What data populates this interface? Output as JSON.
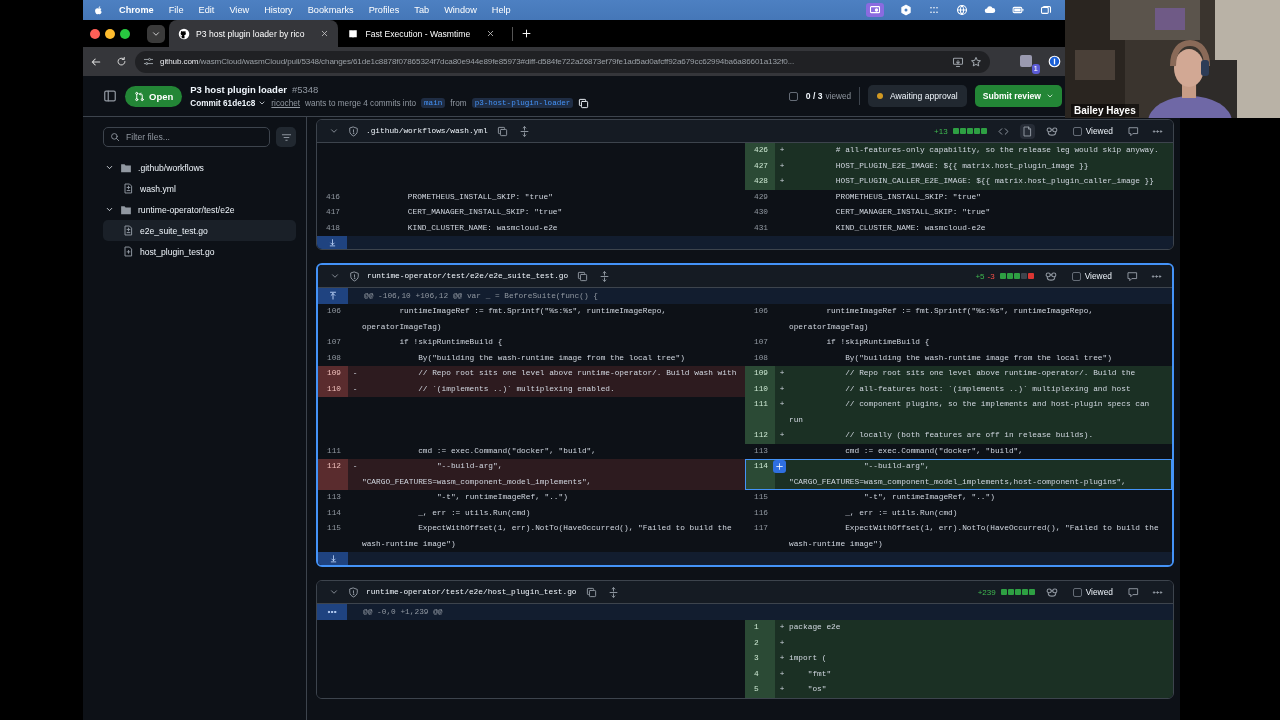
{
  "menubar": {
    "app": "Chrome",
    "menus": [
      "File",
      "Edit",
      "View",
      "History",
      "Bookmarks",
      "Profiles",
      "Tab",
      "Window",
      "Help"
    ]
  },
  "tabs": [
    {
      "title": "P3 host plugin loader by rico",
      "selected": true,
      "kind": "github"
    },
    {
      "title": "Fast Execution - Wasmtime",
      "selected": false,
      "kind": "book"
    }
  ],
  "address_bar": {
    "domain": "github.com",
    "path": "/wasmCloud/wasmCloud/pull/5348/changes/61de1c8878f07865324f7dca80e944e89fe85973#diff-d584fe722a26873ef79fe1ad5ad0afcff92a679cc62994ba6a86601a132f0...",
    "extension_badge": "1"
  },
  "pull_request": {
    "status": "Open",
    "title": "P3 host plugin loader",
    "number": "#5348",
    "commit": "Commit 61de1c8",
    "author": "ricochet",
    "merge_text": "wants to merge 4 commits into",
    "base": "main",
    "from_text": "from",
    "head": "p3-host-plugin-loader",
    "viewed_count": "0 / 3",
    "viewed_label": "viewed",
    "viewed_checked": false,
    "approval": "Awaiting approval",
    "submit": "Submit review"
  },
  "sidebar": {
    "filter_placeholder": "Filter files...",
    "tree": [
      {
        "name": ".github/workflows",
        "kind": "folder",
        "expanded": true,
        "children": [
          {
            "name": "wash.yml",
            "kind": "modified",
            "selected": false
          }
        ]
      },
      {
        "name": "runtime-operator/test/e2e",
        "kind": "folder",
        "expanded": true,
        "children": [
          {
            "name": "e2e_suite_test.go",
            "kind": "modified",
            "selected": true
          },
          {
            "name": "host_plugin_test.go",
            "kind": "added",
            "selected": false
          }
        ]
      }
    ]
  },
  "files": [
    {
      "path": ".github/workflows/wash.yml",
      "selected": false,
      "additions": "+13",
      "diffstat": [
        {
          "color": "#2ea043"
        },
        {
          "color": "#2ea043"
        },
        {
          "color": "#2ea043"
        },
        {
          "color": "#2ea043"
        },
        {
          "color": "#2ea043"
        }
      ],
      "view_toggle": true,
      "viewed": false,
      "viewed_label": "Viewed",
      "expand_below": true,
      "rows": [
        {
          "left": {
            "kind": "empty"
          },
          "right": {
            "kind": "add",
            "num": "426",
            "sign": "+",
            "code": "          # all-features-only capability, so the release leg would skip anyway."
          }
        },
        {
          "left": {
            "kind": "empty"
          },
          "right": {
            "kind": "add",
            "num": "427",
            "sign": "+",
            "code": "          HOST_PLUGIN_E2E_IMAGE: ${{ matrix.host_plugin_image }}"
          }
        },
        {
          "left": {
            "kind": "empty"
          },
          "right": {
            "kind": "add",
            "num": "428",
            "sign": "+",
            "code": "          HOST_PLUGIN_CALLER_E2E_IMAGE: ${{ matrix.host_plugin_caller_image }}"
          }
        },
        {
          "left": {
            "kind": "ctx",
            "num": "416",
            "code": "          PROMETHEUS_INSTALL_SKIP: \"true\""
          },
          "right": {
            "kind": "ctx",
            "num": "429",
            "code": "          PROMETHEUS_INSTALL_SKIP: \"true\""
          }
        },
        {
          "left": {
            "kind": "ctx",
            "num": "417",
            "code": "          CERT_MANAGER_INSTALL_SKIP: \"true\""
          },
          "right": {
            "kind": "ctx",
            "num": "430",
            "code": "          CERT_MANAGER_INSTALL_SKIP: \"true\""
          }
        },
        {
          "left": {
            "kind": "ctx",
            "num": "418",
            "code": "          KIND_CLUSTER_NAME: wasmcloud-e2e"
          },
          "right": {
            "kind": "ctx",
            "num": "431",
            "code": "          KIND_CLUSTER_NAME: wasmcloud-e2e"
          }
        }
      ]
    },
    {
      "path": "runtime-operator/test/e2e/e2e_suite_test.go",
      "selected": true,
      "additions": "+5",
      "deletions": "-3",
      "diffstat": [
        {
          "color": "#2ea043"
        },
        {
          "color": "#2ea043"
        },
        {
          "color": "#2ea043"
        },
        {
          "color": "#3d444d"
        },
        {
          "color": "#da3633"
        }
      ],
      "view_toggle": false,
      "viewed": false,
      "viewed_label": "Viewed",
      "expand_below": true,
      "hunk": {
        "text": "@@ -106,10 +106,12 @@ var _ = BeforeSuite(func() {",
        "kind": "up"
      },
      "rows": [
        {
          "left": {
            "kind": "ctx",
            "num": "106",
            "code": "        runtimeImageRef := fmt.Sprintf(\"%s:%s\", runtimeImageRepo, operatorImageTag)"
          },
          "right": {
            "kind": "ctx",
            "num": "106",
            "code": "        runtimeImageRef := fmt.Sprintf(\"%s:%s\", runtimeImageRepo, operatorImageTag)"
          }
        },
        {
          "left": {
            "kind": "ctx",
            "num": "107",
            "code": "        if !skipRuntimeBuild {"
          },
          "right": {
            "kind": "ctx",
            "num": "107",
            "code": "        if !skipRuntimeBuild {"
          }
        },
        {
          "left": {
            "kind": "ctx",
            "num": "108",
            "code": "            By(\"building the wash-runtime image from the local tree\")"
          },
          "right": {
            "kind": "ctx",
            "num": "108",
            "code": "            By(\"building the wash-runtime image from the local tree\")"
          }
        },
        {
          "left": {
            "kind": "del",
            "num": "109",
            "sign": "-",
            "code": "            // Repo root sits one level above runtime-operator/. Build wash with"
          },
          "right": {
            "kind": "add",
            "num": "109",
            "sign": "+",
            "code": "            // Repo root sits one level above runtime-operator/. Build the"
          }
        },
        {
          "left": {
            "kind": "del",
            "num": "110",
            "sign": "-",
            "code": "            // `(implements ..)` multiplexing enabled."
          },
          "right": {
            "kind": "add",
            "num": "110",
            "sign": "+",
            "code": "            // all-features host: `(implements ..)` multiplexing and host"
          }
        },
        {
          "left": {
            "kind": "empty"
          },
          "right": {
            "kind": "add",
            "num": "111",
            "sign": "+",
            "code": "            // component plugins, so the implements and host-plugin specs can run"
          }
        },
        {
          "left": {
            "kind": "empty"
          },
          "right": {
            "kind": "add",
            "num": "112",
            "sign": "+",
            "code": "            // locally (both features are off in release builds)."
          }
        },
        {
          "left": {
            "kind": "ctx",
            "num": "111",
            "code": "            cmd := exec.Command(\"docker\", \"build\","
          },
          "right": {
            "kind": "ctx",
            "num": "113",
            "code": "            cmd := exec.Command(\"docker\", \"build\","
          }
        },
        {
          "left": {
            "kind": "del",
            "num": "112",
            "sign": "-",
            "code": "                \"--build-arg\",   \"CARGO_FEATURES=wasm_component_model_implements\","
          },
          "right": {
            "kind": "add",
            "num": "114",
            "comment_button": true,
            "code": "                \"--build-arg\", \"CARGO_FEATURES=wasm_component_model_implements,host-component-plugins\","
          }
        },
        {
          "left": {
            "kind": "ctx",
            "num": "113",
            "code": "                \"-t\", runtimeImageRef, \"..\")"
          },
          "right": {
            "kind": "ctx",
            "num": "115",
            "code": "                \"-t\", runtimeImageRef, \"..\")"
          }
        },
        {
          "left": {
            "kind": "ctx",
            "num": "114",
            "code": "            _, err := utils.Run(cmd)"
          },
          "right": {
            "kind": "ctx",
            "num": "116",
            "code": "            _, err := utils.Run(cmd)"
          }
        },
        {
          "left": {
            "kind": "ctx",
            "num": "115",
            "code": "            ExpectWithOffset(1, err).NotTo(HaveOccurred(), \"Failed to build the wash-runtime image\")"
          },
          "right": {
            "kind": "ctx",
            "num": "117",
            "code": "            ExpectWithOffset(1, err).NotTo(HaveOccurred(), \"Failed to build the wash-runtime image\")"
          }
        }
      ]
    },
    {
      "path": "runtime-operator/test/e2e/host_plugin_test.go",
      "selected": false,
      "additions": "+239",
      "diffstat": [
        {
          "color": "#2ea043"
        },
        {
          "color": "#2ea043"
        },
        {
          "color": "#2ea043"
        },
        {
          "color": "#2ea043"
        },
        {
          "color": "#2ea043"
        }
      ],
      "view_toggle": false,
      "viewed": false,
      "viewed_label": "Viewed",
      "expand_below": false,
      "hunk": {
        "text": "@@ -0,0 +1,239 @@",
        "kind": "dots"
      },
      "rows": [
        {
          "left": {
            "kind": "empty"
          },
          "right": {
            "kind": "add",
            "num": "1",
            "sign": "+",
            "code": "package e2e"
          }
        },
        {
          "left": {
            "kind": "empty"
          },
          "right": {
            "kind": "add",
            "num": "2",
            "sign": "+"
          }
        },
        {
          "left": {
            "kind": "empty"
          },
          "right": {
            "kind": "add",
            "num": "3",
            "sign": "+",
            "code": "import ("
          }
        },
        {
          "left": {
            "kind": "empty"
          },
          "right": {
            "kind": "add",
            "num": "4",
            "sign": "+",
            "code": "    \"fmt\""
          }
        },
        {
          "left": {
            "kind": "empty"
          },
          "right": {
            "kind": "add",
            "num": "5",
            "sign": "+",
            "code": "    \"os\""
          }
        }
      ]
    }
  ],
  "video": {
    "name": "Bailey Hayes"
  }
}
